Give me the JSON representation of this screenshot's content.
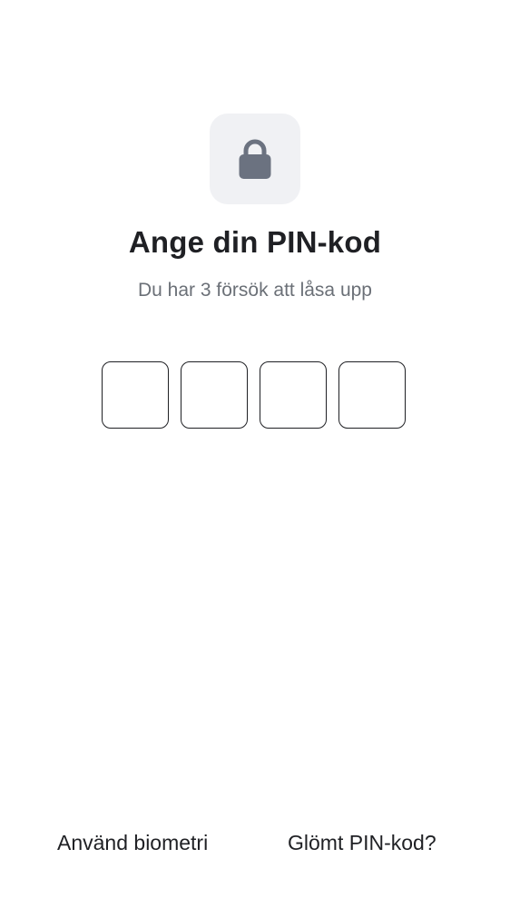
{
  "header": {
    "icon": "lock-icon",
    "title": "Ange din PIN-kod",
    "subtitle": "Du har 3 försök att låsa upp"
  },
  "pin": {
    "length": 4,
    "digits": [
      "",
      "",
      "",
      ""
    ]
  },
  "footer": {
    "biometric_label": "Använd biometri",
    "forgot_label": "Glömt PIN-kod?"
  },
  "colors": {
    "text": "#1f2024",
    "muted": "#6b7077",
    "tile_bg": "#f0f1f4",
    "icon": "#6b7280"
  }
}
